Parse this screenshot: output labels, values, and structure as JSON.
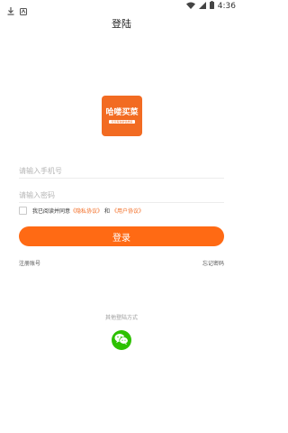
{
  "status_bar": {
    "time": "4:36"
  },
  "header": {
    "title": "登陆"
  },
  "logo": {
    "title": "哈喽买菜",
    "subtitle": "天天有新鲜优质菜"
  },
  "form": {
    "phone_placeholder": "请输入手机号",
    "password_placeholder": "请输入密码",
    "agreement_prefix": "我已阅读并同意",
    "privacy_link": "《隐私协议》",
    "agreement_and": "和",
    "user_link": "《用户协议》",
    "login_label": "登录"
  },
  "links": {
    "register": "注册账号",
    "forgot": "忘记密码"
  },
  "other": {
    "label": "其他登陆方式"
  },
  "colors": {
    "accent": "#ff6a14",
    "wechat": "#2dc100"
  }
}
